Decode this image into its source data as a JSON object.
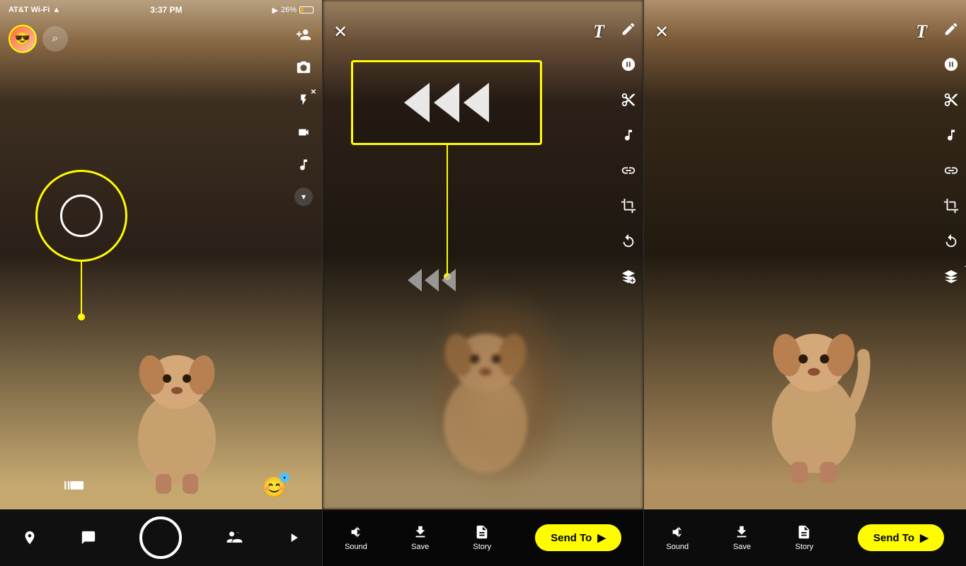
{
  "panels": {
    "panel1": {
      "status_bar": {
        "carrier": "AT&T Wi-Fi",
        "time": "3:37 PM",
        "signal_icon": "signal",
        "battery_percent": "26%"
      },
      "bottom_nav": {
        "location_label": "location",
        "chat_label": "chat",
        "camera_label": "camera",
        "friends_label": "friends",
        "play_label": "play"
      }
    },
    "panel2": {
      "top_bar": {
        "close_label": "✕",
        "text_label": "T"
      },
      "right_toolbar": {
        "pencil": "✏",
        "scissors": "✂",
        "music": "♪",
        "link": "🔗",
        "crop": "⊡",
        "loop": "↻",
        "layers": "⊕"
      },
      "bottom_bar": {
        "sound_label": "Sound",
        "save_label": "Save",
        "story_label": "Story",
        "send_label": "Send To",
        "arrow": "▶"
      },
      "sticker": {
        "type": "rewind"
      }
    },
    "panel3": {
      "top_bar": {
        "close_label": "✕",
        "text_label": "T"
      },
      "right_toolbar": {
        "pencil": "✏",
        "scissors": "✂",
        "music": "♪",
        "link": "🔗",
        "crop": "⊡",
        "loop": "↻",
        "layers": "⊕"
      },
      "bottom_bar": {
        "sound_label": "Sound",
        "save_label": "Save",
        "story_label": "Story",
        "send_label": "Send To",
        "arrow": "▶"
      }
    }
  },
  "icons": {
    "close": "✕",
    "text_tool": "T",
    "pencil": "✏",
    "sticker": "☺",
    "flip": "⇄",
    "flash": "⚡",
    "flash_off": "✕",
    "video": "▦",
    "music": "♪",
    "chevron_down": "⌄",
    "location": "◎",
    "chat": "◻",
    "camera": "◉",
    "friends": "⚇",
    "play": "▷",
    "sound": "◄",
    "save": "↓",
    "story": "⊞",
    "send_arrow": "▶",
    "scissors": "✂",
    "link": "⊘",
    "crop": "⊡",
    "loop": "↺",
    "layers_add": "⊕",
    "rewind_arrow": "◀◀"
  }
}
